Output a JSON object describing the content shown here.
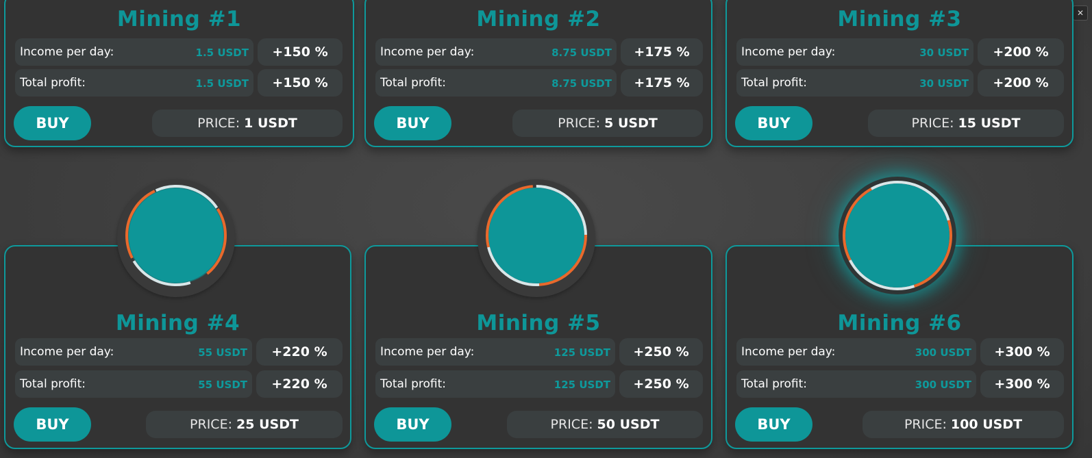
{
  "window": {
    "close_label": "✕"
  },
  "colors": {
    "accent": "#0e9698",
    "card_bg": "#333333",
    "row_bg": "#3a3f40",
    "ring_orange": "#e9692c",
    "ring_white": "#d8e6e8"
  },
  "labels": {
    "income": "Income per day:",
    "total": "Total profit:",
    "buy": "BUY",
    "price": "PRICE:"
  },
  "cards": [
    {
      "title": "Mining #1",
      "income": "1.5 USDT",
      "income_pct": "+150 %",
      "total": "1.5 USDT",
      "total_pct": "+150 %",
      "price": "1 USDT"
    },
    {
      "title": "Mining #2",
      "income": "8.75 USDT",
      "income_pct": "+175 %",
      "total": "8.75 USDT",
      "total_pct": "+175 %",
      "price": "5 USDT"
    },
    {
      "title": "Mining #3",
      "income": "30 USDT",
      "income_pct": "+200 %",
      "total": "30 USDT",
      "total_pct": "+200 %",
      "price": "15 USDT"
    },
    {
      "title": "Mining #4",
      "income": "55 USDT",
      "income_pct": "+220 %",
      "total": "55 USDT",
      "total_pct": "+220 %",
      "price": "25 USDT"
    },
    {
      "title": "Mining #5",
      "income": "125 USDT",
      "income_pct": "+250 %",
      "total": "125 USDT",
      "total_pct": "+250 %",
      "price": "50 USDT"
    },
    {
      "title": "Mining #6",
      "income": "300 USDT",
      "income_pct": "+300 %",
      "total": "300 USDT",
      "total_pct": "+300 %",
      "price": "100 USDT"
    }
  ]
}
